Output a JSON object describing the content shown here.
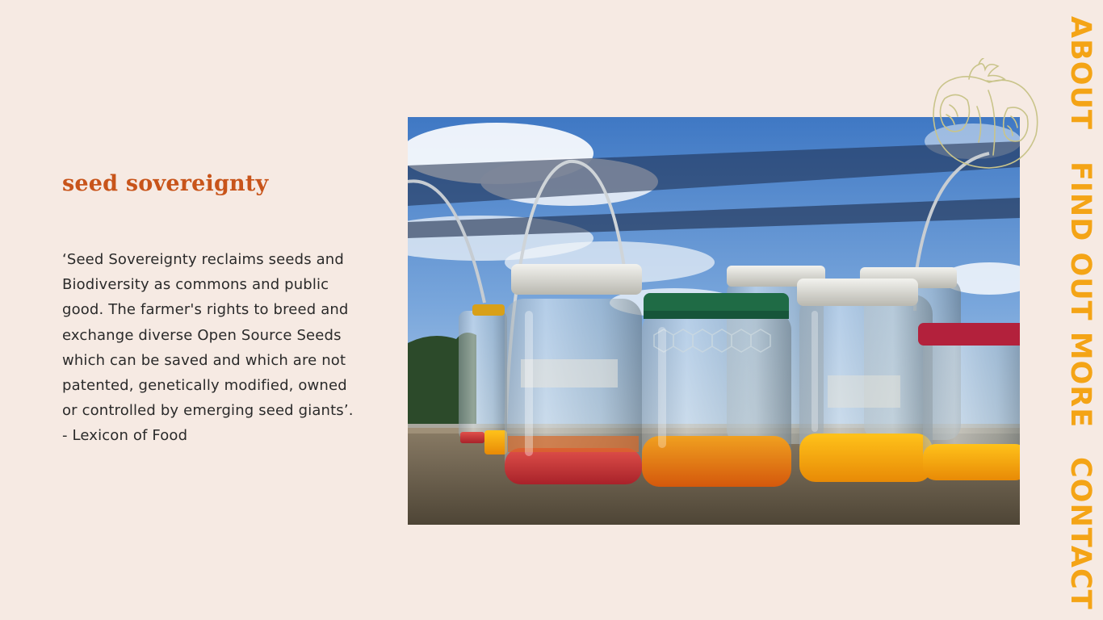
{
  "content": {
    "heading": "seed sovereignty",
    "quote_lines": [
      "‘Seed Sovereignty reclaims seeds and",
      "Biodiversity as commons and public",
      "good. The farmer's rights to breed and",
      "exchange diverse Open Source Seeds",
      "which can be saved and which are not",
      "patented, genetically modified, owned",
      "or controlled by emerging seed giants’.",
      "- Lexicon of Food"
    ]
  },
  "nav": {
    "about": "ABOUT",
    "find_out_more": "FIND OUT MORE",
    "contact": "CONTACT"
  },
  "colors": {
    "background": "#f6eae3",
    "heading": "#c8541a",
    "nav": "#f4a416",
    "tomato_line": "#c9c48a"
  }
}
